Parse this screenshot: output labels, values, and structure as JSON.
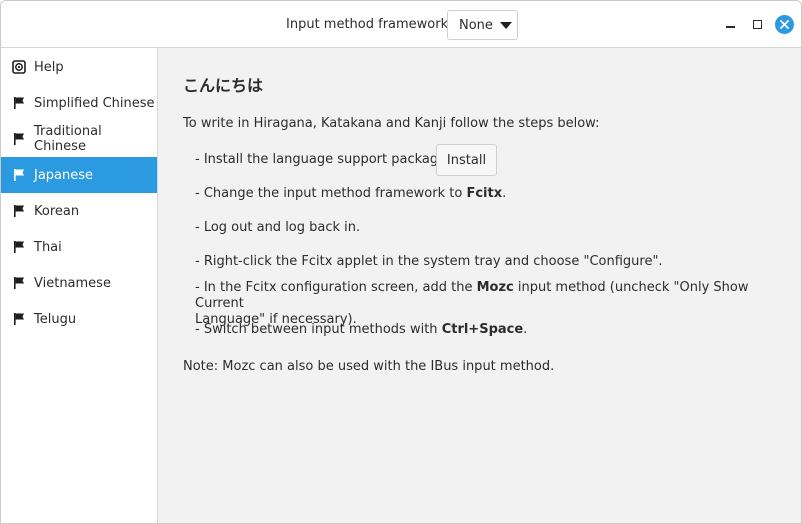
{
  "titlebar": {
    "framework_label": "Input method framework:",
    "framework_value": "None"
  },
  "sidebar": {
    "items": [
      {
        "label": "Help",
        "icon": "help-icon"
      },
      {
        "label": "Simplified Chinese",
        "icon": "flag-icon"
      },
      {
        "label": "Traditional Chinese",
        "icon": "flag-icon"
      },
      {
        "label": "Japanese",
        "icon": "flag-icon",
        "selected": true
      },
      {
        "label": "Korean",
        "icon": "flag-icon"
      },
      {
        "label": "Thai",
        "icon": "flag-icon"
      },
      {
        "label": "Vietnamese",
        "icon": "flag-icon"
      },
      {
        "label": "Telugu",
        "icon": "flag-icon"
      }
    ]
  },
  "main": {
    "heading": "こんにちは",
    "intro": "To write in Hiragana, Katakana and Kanji follow the steps below:",
    "steps": {
      "install": "- Install the language support packages:",
      "install_button": "Install",
      "framework_pre": "- Change the input method framework to ",
      "framework_bold": "Fcitx",
      "framework_post": ".",
      "logout": "- Log out and log back in.",
      "configure": "- Right-click the Fcitx applet in the system tray and choose \"Configure\".",
      "mozc_pre": "- In the Fcitx configuration screen, add the ",
      "mozc_bold": "Mozc",
      "mozc_post_line1": " input method (uncheck \"Only Show Current",
      "mozc_line2": "Language\" if necessary).",
      "switch_pre": "- Switch between input methods with ",
      "switch_bold": "Ctrl+Space",
      "switch_post": "."
    },
    "note": "Note: Mozc can also be used with the IBus input method."
  },
  "colors": {
    "accent": "#2b9ae0",
    "window_bg": "#f2f2f2",
    "sidebar_bg": "#ffffff"
  }
}
